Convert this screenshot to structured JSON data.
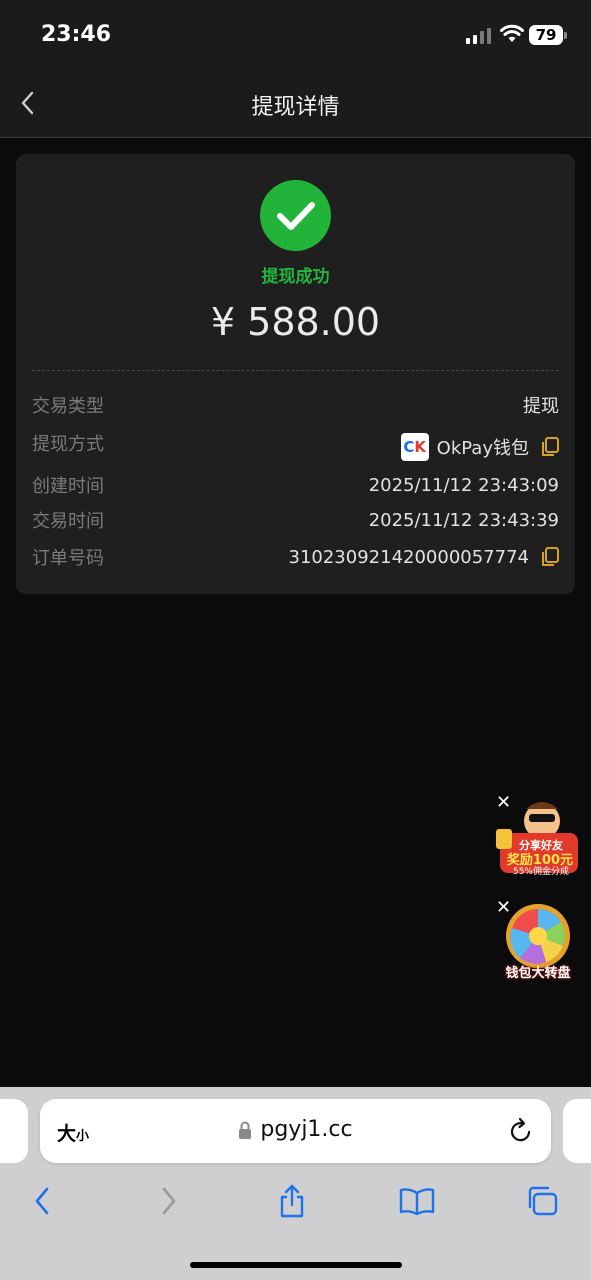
{
  "status": {
    "time": "23:46",
    "battery": "79"
  },
  "nav": {
    "title": "提现详情"
  },
  "result": {
    "status_text": "提现成功",
    "amount": "¥ 588.00",
    "accent": "#22b33b"
  },
  "details": [
    {
      "label": "交易类型",
      "value": "提现"
    },
    {
      "label": "提现方式",
      "value": "OkPay钱包"
    },
    {
      "label": "创建时间",
      "value": "2025/11/12 23:43:09"
    },
    {
      "label": "交易时间",
      "value": "2025/11/12 23:43:39"
    },
    {
      "label": "订单号码",
      "value": "310230921420000057774"
    }
  ],
  "payment_logo": {
    "left": "C",
    "right": "K"
  },
  "ads": [
    {
      "name": "share-friends-promo",
      "line1": "分享好友",
      "line2": "奖励100元",
      "line3": "55%佣金分成"
    },
    {
      "name": "wallet-wheel-promo",
      "caption": "钱包大转盘"
    }
  ],
  "browser": {
    "text_size_big": "大",
    "text_size_small": "小",
    "url": "pgyj1.cc"
  }
}
